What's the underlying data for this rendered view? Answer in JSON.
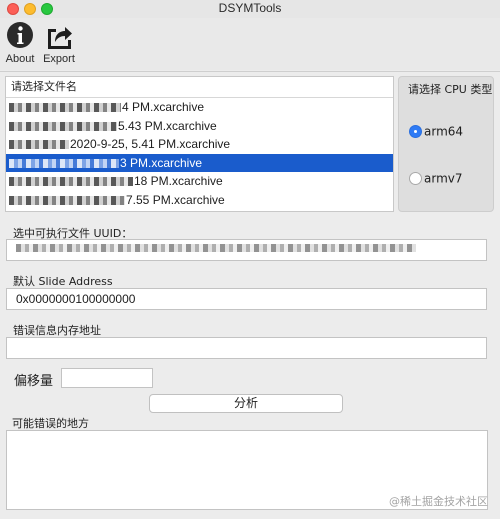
{
  "window": {
    "title": "DSYMTools"
  },
  "toolbar": {
    "about_label": "About",
    "export_label": "Export"
  },
  "file_list": {
    "header": "请选择文件名",
    "rows": [
      {
        "visible_text": "4 PM.xcarchive",
        "selected": false
      },
      {
        "visible_text": "5.43 PM.xcarchive",
        "selected": false
      },
      {
        "visible_text": "2020-9-25, 5.41 PM.xcarchive",
        "selected": false
      },
      {
        "visible_text": "3 PM.xcarchive",
        "selected": true
      },
      {
        "visible_text": "18 PM.xcarchive",
        "selected": false
      },
      {
        "visible_text": "7.55 PM.xcarchive",
        "selected": false
      }
    ]
  },
  "cpu": {
    "title": "请选择 CPU 类型",
    "options": [
      {
        "label": "arm64",
        "checked": true
      },
      {
        "label": "armv7",
        "checked": false
      }
    ]
  },
  "uuid": {
    "label": "选中可执行文件 UUID："
  },
  "slide": {
    "label": "默认 Slide Address",
    "value": "0x0000000100000000"
  },
  "error_address": {
    "label": "错误信息内存地址",
    "value": ""
  },
  "offset": {
    "label": "偏移量",
    "value": ""
  },
  "analyze": {
    "label": "分析"
  },
  "result": {
    "label": "可能错误的地方"
  },
  "watermark": {
    "text": "@稀土掘金技术社区"
  },
  "colors": {
    "selection": "#1a5ccc",
    "radio_on": "#2f7bf5"
  }
}
